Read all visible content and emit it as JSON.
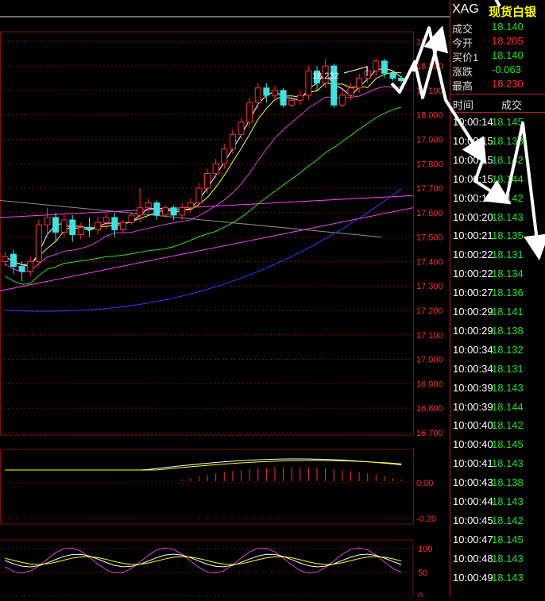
{
  "quote": {
    "symbol": "XAG",
    "name": "现货白银",
    "rows": [
      {
        "label": "成交",
        "value": "18.140",
        "color": "#22e022"
      },
      {
        "label": "今开",
        "value": "18.205",
        "color": "#ff3030"
      },
      {
        "label": "买价1",
        "value": "18.140",
        "color": "#22e022"
      },
      {
        "label": "涨跌",
        "value": "-0.063",
        "color": "#22e022"
      },
      {
        "label": "最高",
        "value": "18.230",
        "color": "#ff3030"
      }
    ]
  },
  "ticks": {
    "header_time": "时间",
    "header_price": "成交",
    "rows": [
      {
        "time": "10:00:14",
        "price": "18.145"
      },
      {
        "time": "10:00:15",
        "price": "18.138"
      },
      {
        "time": "10:00:15",
        "price": "18.142"
      },
      {
        "time": "10:00:15",
        "price": "18.144"
      },
      {
        "time": "10:00:17",
        "price": "18.142"
      },
      {
        "time": "10:00:20",
        "price": "18.143"
      },
      {
        "time": "10:00:21",
        "price": "18.135"
      },
      {
        "time": "10:00:22",
        "price": "18.131"
      },
      {
        "time": "10:00:22",
        "price": "18.134"
      },
      {
        "time": "10:00:27",
        "price": "18.136"
      },
      {
        "time": "10:00:29",
        "price": "18.141"
      },
      {
        "time": "10:00:29",
        "price": "18.138"
      },
      {
        "time": "10:00:34",
        "price": "18.132"
      },
      {
        "time": "10:00:34",
        "price": "18.131"
      },
      {
        "time": "10:00:39",
        "price": "18.143"
      },
      {
        "time": "10:00:39",
        "price": "18.144"
      },
      {
        "time": "10:00:40",
        "price": "18.142"
      },
      {
        "time": "10:00:40",
        "price": "18.145"
      },
      {
        "time": "10:00:41",
        "price": "18.143"
      },
      {
        "time": "10:00:43",
        "price": "18.138"
      },
      {
        "time": "10:00:44",
        "price": "18.143"
      },
      {
        "time": "10:00:45",
        "price": "18.142"
      },
      {
        "time": "10:00:47",
        "price": "18.145"
      },
      {
        "time": "10:00:48",
        "price": "18.143"
      },
      {
        "time": "10:00:49",
        "price": "18.143"
      }
    ]
  },
  "chart_data": {
    "type": "candlestick",
    "high_label": "18.232",
    "price_axis_ticks": [
      "18.300",
      "18.200",
      "18.100",
      "18.000",
      "17.900",
      "17.800",
      "17.700",
      "17.600",
      "17.500",
      "17.400",
      "17.300",
      "17.200",
      "17.100",
      "17.000",
      "16.900",
      "16.800",
      "16.700"
    ],
    "price_ylim": [
      16.69,
      18.34
    ],
    "macd_axis_ticks": [
      "0.00",
      "-0.20"
    ],
    "kdj_axis_ticks": [
      "100",
      "50",
      "0"
    ],
    "colors": {
      "up": "#ff3030",
      "down": "#40e0e0",
      "ma5": "#ffffff",
      "ma10": "#ffff40",
      "ma20": "#e040e0",
      "ma30": "#30e030",
      "ma60": "#3040ff",
      "ref1": "#ff40ff",
      "ref2": "#909090",
      "grid": "#7a1010"
    },
    "candles": [
      [
        17.4,
        17.42,
        17.38,
        17.44
      ],
      [
        17.43,
        17.38,
        17.35,
        17.45
      ],
      [
        17.38,
        17.36,
        17.32,
        17.4
      ],
      [
        17.36,
        17.4,
        17.34,
        17.42
      ],
      [
        17.4,
        17.55,
        17.38,
        17.57
      ],
      [
        17.55,
        17.58,
        17.5,
        17.62
      ],
      [
        17.58,
        17.52,
        17.48,
        17.6
      ],
      [
        17.52,
        17.57,
        17.5,
        17.59
      ],
      [
        17.57,
        17.51,
        17.48,
        17.59
      ],
      [
        17.51,
        17.54,
        17.49,
        17.56
      ],
      [
        17.54,
        17.53,
        17.5,
        17.58
      ],
      [
        17.53,
        17.56,
        17.51,
        17.58
      ],
      [
        17.56,
        17.58,
        17.53,
        17.6
      ],
      [
        17.58,
        17.53,
        17.5,
        17.6
      ],
      [
        17.53,
        17.56,
        17.52,
        17.57
      ],
      [
        17.56,
        17.59,
        17.55,
        17.6
      ],
      [
        17.59,
        17.62,
        17.56,
        17.7
      ],
      [
        17.62,
        17.64,
        17.6,
        17.66
      ],
      [
        17.64,
        17.59,
        17.57,
        17.65
      ],
      [
        17.59,
        17.62,
        17.58,
        17.63
      ],
      [
        17.62,
        17.59,
        17.57,
        17.63
      ],
      [
        17.59,
        17.62,
        17.57,
        17.64
      ],
      [
        17.62,
        17.64,
        17.6,
        17.66
      ],
      [
        17.64,
        17.7,
        17.62,
        17.72
      ],
      [
        17.7,
        17.76,
        17.68,
        17.78
      ],
      [
        17.76,
        17.8,
        17.74,
        17.82
      ],
      [
        17.8,
        17.86,
        17.78,
        17.88
      ],
      [
        17.86,
        17.92,
        17.84,
        17.94
      ],
      [
        17.92,
        17.97,
        17.9,
        17.99
      ],
      [
        17.97,
        18.05,
        17.95,
        18.07
      ],
      [
        18.05,
        18.11,
        18.02,
        18.13
      ],
      [
        18.11,
        18.08,
        18.05,
        18.13
      ],
      [
        18.08,
        18.1,
        18.06,
        18.12
      ],
      [
        18.1,
        18.04,
        18.03,
        18.11
      ],
      [
        18.04,
        18.06,
        18.03,
        18.08
      ],
      [
        18.06,
        18.08,
        18.04,
        18.1
      ],
      [
        18.08,
        18.18,
        18.06,
        18.2
      ],
      [
        18.18,
        18.13,
        18.1,
        18.2
      ],
      [
        18.13,
        18.2,
        18.11,
        18.23
      ],
      [
        18.2,
        18.04,
        18.03,
        18.21
      ],
      [
        18.04,
        18.08,
        18.03,
        18.1
      ],
      [
        18.08,
        18.11,
        18.06,
        18.13
      ],
      [
        18.11,
        18.15,
        18.09,
        18.17
      ],
      [
        18.15,
        18.18,
        18.13,
        18.2
      ],
      [
        18.18,
        18.22,
        18.16,
        18.23
      ],
      [
        18.22,
        18.17,
        18.15,
        18.23
      ],
      [
        18.17,
        18.15,
        18.14,
        18.18
      ],
      [
        18.15,
        18.14,
        18.13,
        18.16
      ]
    ]
  }
}
